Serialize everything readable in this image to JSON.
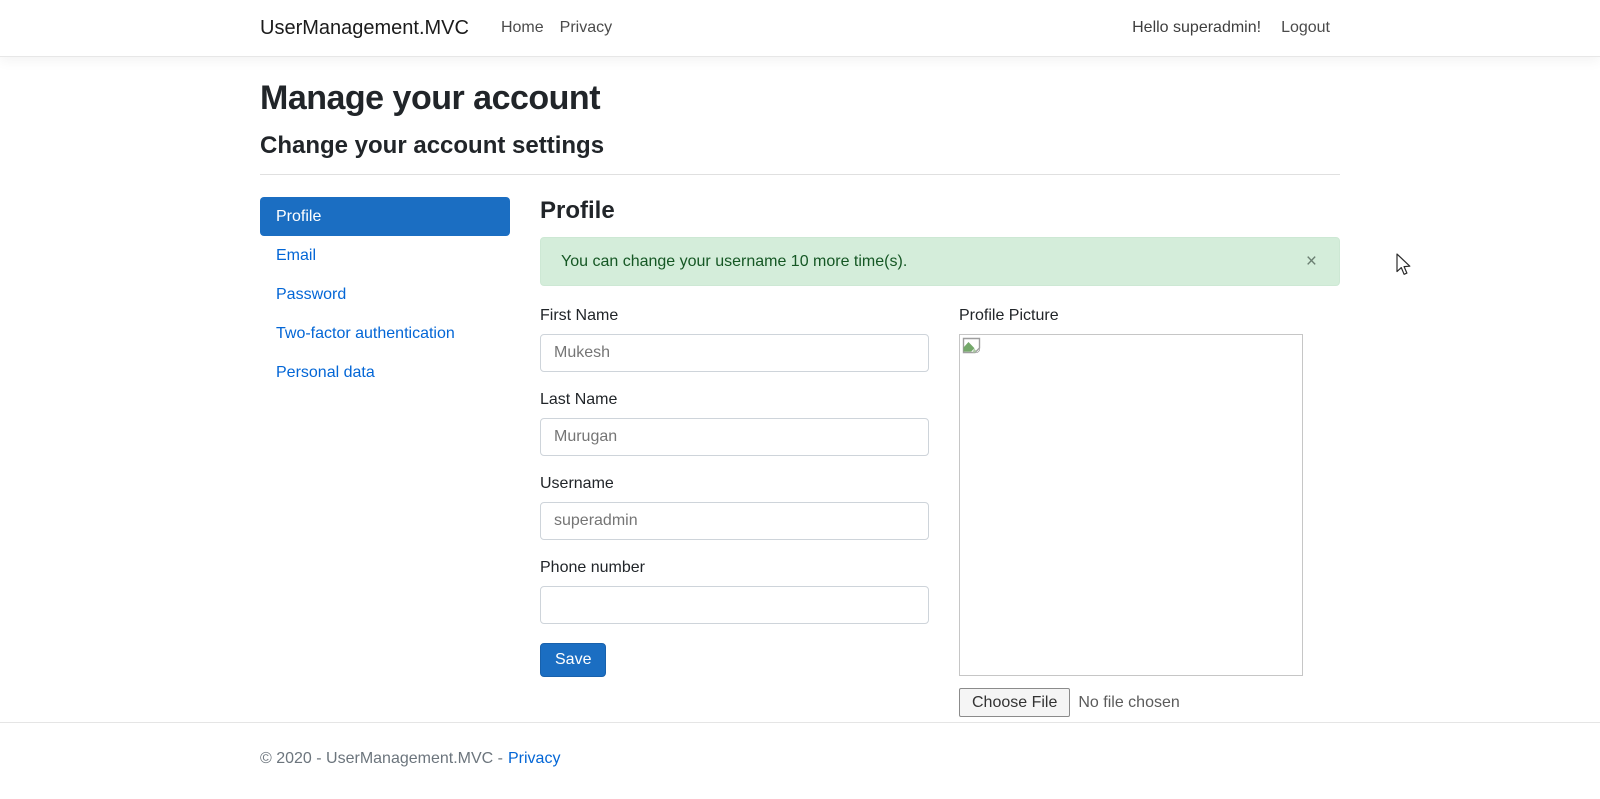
{
  "navbar": {
    "brand": "UserManagement.MVC",
    "links": [
      {
        "label": "Home"
      },
      {
        "label": "Privacy"
      }
    ],
    "greeting": "Hello superadmin!",
    "logout_label": "Logout"
  },
  "page": {
    "title": "Manage your account",
    "subtitle": "Change your account settings"
  },
  "sidebar": {
    "items": [
      {
        "label": "Profile",
        "active": true
      },
      {
        "label": "Email",
        "active": false
      },
      {
        "label": "Password",
        "active": false
      },
      {
        "label": "Two-factor authentication",
        "active": false
      },
      {
        "label": "Personal data",
        "active": false
      }
    ]
  },
  "main": {
    "heading": "Profile",
    "alert": {
      "message": "You can change your username 10 more time(s).",
      "close_label": "×"
    },
    "form": {
      "fields": {
        "first_name": {
          "label": "First Name",
          "value": "Mukesh"
        },
        "last_name": {
          "label": "Last Name",
          "value": "Murugan"
        },
        "username": {
          "label": "Username",
          "value": "superadmin"
        },
        "phone": {
          "label": "Phone number",
          "value": ""
        }
      },
      "save_label": "Save"
    },
    "picture": {
      "label": "Profile Picture",
      "broken_image_icon": "broken-image-icon",
      "file_button_label": "Choose File",
      "file_status": "No file chosen"
    }
  },
  "footer": {
    "copyright": "© 2020 - UserManagement.MVC -",
    "privacy_label": "Privacy"
  },
  "colors": {
    "accent_blue": "#1b6ec2",
    "link_blue": "#0366d6",
    "alert_bg": "#d4edda",
    "alert_text": "#155724"
  }
}
